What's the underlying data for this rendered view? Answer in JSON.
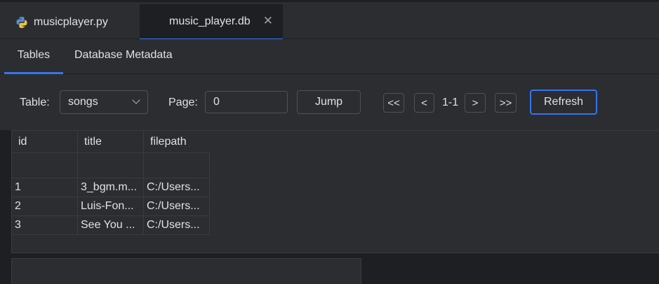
{
  "file_tabs": [
    {
      "label": "musicplayer.py",
      "icon": "python-file-icon",
      "active": false
    },
    {
      "label": "music_player.db",
      "icon": "close-icon",
      "active": true
    }
  ],
  "close_glyph": "✕",
  "sub_tabs": [
    {
      "label": "Tables",
      "active": true
    },
    {
      "label": "Database Metadata",
      "active": false
    }
  ],
  "toolbar": {
    "table_label": "Table:",
    "table_value": "songs",
    "page_label": "Page:",
    "page_value": "0",
    "jump_label": "Jump",
    "first_label": "<<",
    "prev_label": "<",
    "page_range": "1-1",
    "next_label": ">",
    "last_label": ">>",
    "refresh_label": "Refresh"
  },
  "table": {
    "columns": [
      "id",
      "title",
      "filepath"
    ],
    "rows": [
      [
        "",
        "",
        ""
      ],
      [
        "1",
        "3_bgm.m...",
        "C:/Users..."
      ],
      [
        "2",
        "Luis-Fon...",
        "C:/Users..."
      ],
      [
        "3",
        "See You ...",
        "C:/Users..."
      ]
    ]
  },
  "colors": {
    "accent": "#3574f0",
    "panel": "#2b2d30",
    "background": "#1e1f22"
  }
}
